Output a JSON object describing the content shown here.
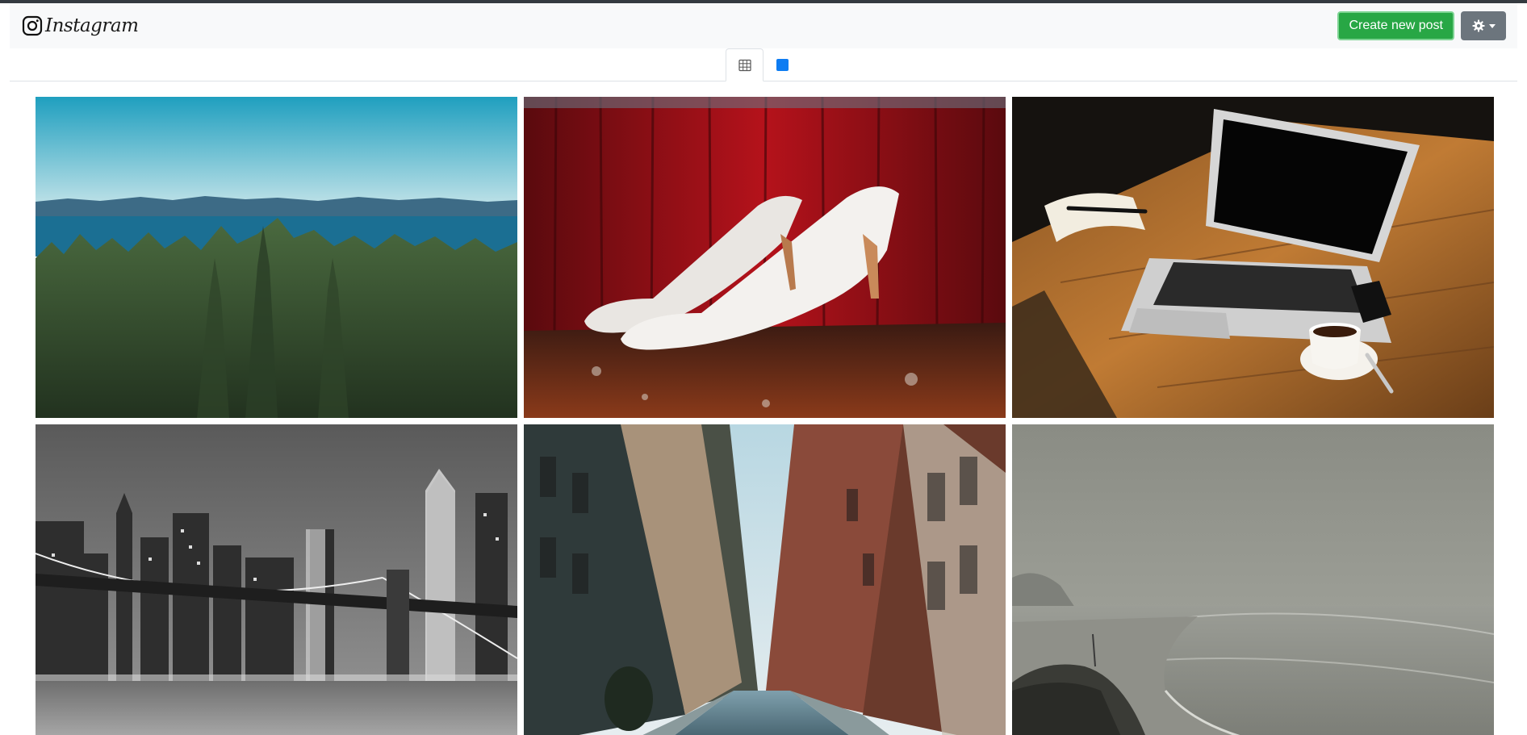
{
  "navbar": {
    "brand": {
      "name": "Instagram",
      "icon": "instagram-logo-icon"
    },
    "create_button": {
      "label": "Create new post",
      "color": "#28a745"
    },
    "settings_button": {
      "icon": "gear-icon",
      "dropdown_icon": "caret-down-icon",
      "color": "#6c757d"
    }
  },
  "view_tabs": [
    {
      "icon": "grid-view-icon",
      "active": true
    },
    {
      "icon": "single-view-icon",
      "active": false,
      "color": "#0d7cf2"
    }
  ],
  "gallery": {
    "photos": [
      {
        "subject": "forest-lake-photo"
      },
      {
        "subject": "white-heels-photo"
      },
      {
        "subject": "laptop-coffee-photo"
      },
      {
        "subject": "city-bridge-night-photo"
      },
      {
        "subject": "city-street-photo"
      },
      {
        "subject": "foggy-beach-photo"
      }
    ]
  }
}
